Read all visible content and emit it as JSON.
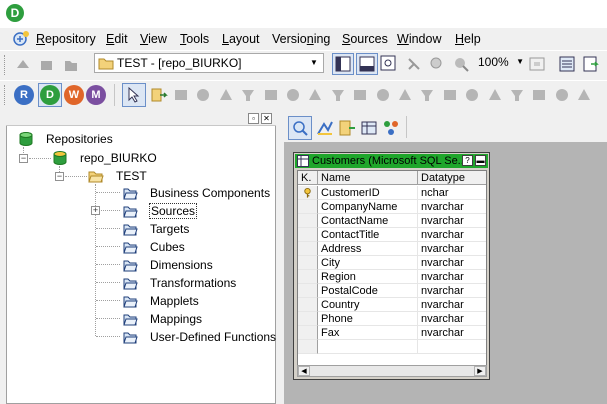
{
  "app": {
    "logo_letter": "D"
  },
  "menubar": {
    "items": [
      {
        "label": "Repository",
        "u": "R"
      },
      {
        "label": "Edit",
        "u": "E"
      },
      {
        "label": "View",
        "u": "V"
      },
      {
        "label": "Tools",
        "u": "T"
      },
      {
        "label": "Layout",
        "u": "L"
      },
      {
        "label": "Versioning",
        "u": "n"
      },
      {
        "label": "Sources",
        "u": "S"
      },
      {
        "label": "Window",
        "u": "W"
      },
      {
        "label": "Help",
        "u": "H"
      }
    ]
  },
  "toolbar": {
    "repository_folder": "TEST - [repo_BIURKO]",
    "zoom": "100%"
  },
  "tool_letters": {
    "r": "R",
    "d": "D",
    "w": "W",
    "m": "M"
  },
  "navigator": {
    "root": "Repositories",
    "repo": "repo_BIURKO",
    "folder": "TEST",
    "nodes": [
      "Business Components",
      "Sources",
      "Targets",
      "Cubes",
      "Dimensions",
      "Transformations",
      "Mapplets",
      "Mappings",
      "User-Defined Functions"
    ],
    "selected": "Sources"
  },
  "source_window": {
    "title": "Customers (Microsoft SQL Se...",
    "columns": {
      "key": "K.",
      "name": "Name",
      "datatype": "Datatype"
    },
    "rows": [
      {
        "name": "CustomerID",
        "datatype": "nchar",
        "key": true
      },
      {
        "name": "CompanyName",
        "datatype": "nvarchar",
        "key": false
      },
      {
        "name": "ContactName",
        "datatype": "nvarchar",
        "key": false
      },
      {
        "name": "ContactTitle",
        "datatype": "nvarchar",
        "key": false
      },
      {
        "name": "Address",
        "datatype": "nvarchar",
        "key": false
      },
      {
        "name": "City",
        "datatype": "nvarchar",
        "key": false
      },
      {
        "name": "Region",
        "datatype": "nvarchar",
        "key": false
      },
      {
        "name": "PostalCode",
        "datatype": "nvarchar",
        "key": false
      },
      {
        "name": "Country",
        "datatype": "nvarchar",
        "key": false
      },
      {
        "name": "Phone",
        "datatype": "nvarchar",
        "key": false
      },
      {
        "name": "Fax",
        "datatype": "nvarchar",
        "key": false
      }
    ]
  },
  "colors": {
    "source_title": "#1fa62b",
    "workspace": "#b4b4b4",
    "tool_r": "#3b6fc4",
    "tool_d": "#2e9e3e",
    "tool_w": "#e0662a",
    "tool_m": "#7b4fa0"
  }
}
